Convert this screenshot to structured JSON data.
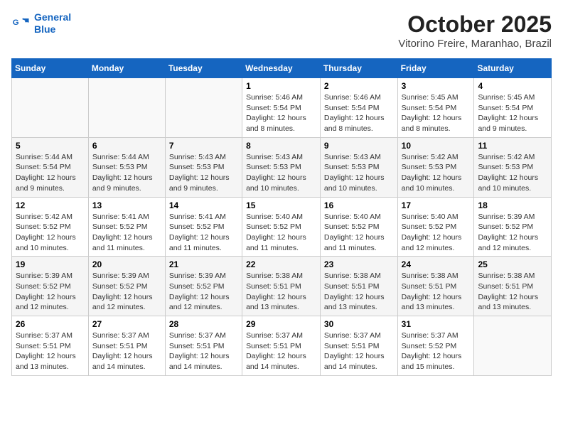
{
  "header": {
    "logo_line1": "General",
    "logo_line2": "Blue",
    "month": "October 2025",
    "location": "Vitorino Freire, Maranhao, Brazil"
  },
  "days_of_week": [
    "Sunday",
    "Monday",
    "Tuesday",
    "Wednesday",
    "Thursday",
    "Friday",
    "Saturday"
  ],
  "weeks": [
    [
      {
        "day": "",
        "info": ""
      },
      {
        "day": "",
        "info": ""
      },
      {
        "day": "",
        "info": ""
      },
      {
        "day": "1",
        "info": "Sunrise: 5:46 AM\nSunset: 5:54 PM\nDaylight: 12 hours and 8 minutes."
      },
      {
        "day": "2",
        "info": "Sunrise: 5:46 AM\nSunset: 5:54 PM\nDaylight: 12 hours and 8 minutes."
      },
      {
        "day": "3",
        "info": "Sunrise: 5:45 AM\nSunset: 5:54 PM\nDaylight: 12 hours and 8 minutes."
      },
      {
        "day": "4",
        "info": "Sunrise: 5:45 AM\nSunset: 5:54 PM\nDaylight: 12 hours and 9 minutes."
      }
    ],
    [
      {
        "day": "5",
        "info": "Sunrise: 5:44 AM\nSunset: 5:54 PM\nDaylight: 12 hours and 9 minutes."
      },
      {
        "day": "6",
        "info": "Sunrise: 5:44 AM\nSunset: 5:53 PM\nDaylight: 12 hours and 9 minutes."
      },
      {
        "day": "7",
        "info": "Sunrise: 5:43 AM\nSunset: 5:53 PM\nDaylight: 12 hours and 9 minutes."
      },
      {
        "day": "8",
        "info": "Sunrise: 5:43 AM\nSunset: 5:53 PM\nDaylight: 12 hours and 10 minutes."
      },
      {
        "day": "9",
        "info": "Sunrise: 5:43 AM\nSunset: 5:53 PM\nDaylight: 12 hours and 10 minutes."
      },
      {
        "day": "10",
        "info": "Sunrise: 5:42 AM\nSunset: 5:53 PM\nDaylight: 12 hours and 10 minutes."
      },
      {
        "day": "11",
        "info": "Sunrise: 5:42 AM\nSunset: 5:53 PM\nDaylight: 12 hours and 10 minutes."
      }
    ],
    [
      {
        "day": "12",
        "info": "Sunrise: 5:42 AM\nSunset: 5:52 PM\nDaylight: 12 hours and 10 minutes."
      },
      {
        "day": "13",
        "info": "Sunrise: 5:41 AM\nSunset: 5:52 PM\nDaylight: 12 hours and 11 minutes."
      },
      {
        "day": "14",
        "info": "Sunrise: 5:41 AM\nSunset: 5:52 PM\nDaylight: 12 hours and 11 minutes."
      },
      {
        "day": "15",
        "info": "Sunrise: 5:40 AM\nSunset: 5:52 PM\nDaylight: 12 hours and 11 minutes."
      },
      {
        "day": "16",
        "info": "Sunrise: 5:40 AM\nSunset: 5:52 PM\nDaylight: 12 hours and 11 minutes."
      },
      {
        "day": "17",
        "info": "Sunrise: 5:40 AM\nSunset: 5:52 PM\nDaylight: 12 hours and 12 minutes."
      },
      {
        "day": "18",
        "info": "Sunrise: 5:39 AM\nSunset: 5:52 PM\nDaylight: 12 hours and 12 minutes."
      }
    ],
    [
      {
        "day": "19",
        "info": "Sunrise: 5:39 AM\nSunset: 5:52 PM\nDaylight: 12 hours and 12 minutes."
      },
      {
        "day": "20",
        "info": "Sunrise: 5:39 AM\nSunset: 5:52 PM\nDaylight: 12 hours and 12 minutes."
      },
      {
        "day": "21",
        "info": "Sunrise: 5:39 AM\nSunset: 5:52 PM\nDaylight: 12 hours and 12 minutes."
      },
      {
        "day": "22",
        "info": "Sunrise: 5:38 AM\nSunset: 5:51 PM\nDaylight: 12 hours and 13 minutes."
      },
      {
        "day": "23",
        "info": "Sunrise: 5:38 AM\nSunset: 5:51 PM\nDaylight: 12 hours and 13 minutes."
      },
      {
        "day": "24",
        "info": "Sunrise: 5:38 AM\nSunset: 5:51 PM\nDaylight: 12 hours and 13 minutes."
      },
      {
        "day": "25",
        "info": "Sunrise: 5:38 AM\nSunset: 5:51 PM\nDaylight: 12 hours and 13 minutes."
      }
    ],
    [
      {
        "day": "26",
        "info": "Sunrise: 5:37 AM\nSunset: 5:51 PM\nDaylight: 12 hours and 13 minutes."
      },
      {
        "day": "27",
        "info": "Sunrise: 5:37 AM\nSunset: 5:51 PM\nDaylight: 12 hours and 14 minutes."
      },
      {
        "day": "28",
        "info": "Sunrise: 5:37 AM\nSunset: 5:51 PM\nDaylight: 12 hours and 14 minutes."
      },
      {
        "day": "29",
        "info": "Sunrise: 5:37 AM\nSunset: 5:51 PM\nDaylight: 12 hours and 14 minutes."
      },
      {
        "day": "30",
        "info": "Sunrise: 5:37 AM\nSunset: 5:51 PM\nDaylight: 12 hours and 14 minutes."
      },
      {
        "day": "31",
        "info": "Sunrise: 5:37 AM\nSunset: 5:52 PM\nDaylight: 12 hours and 15 minutes."
      },
      {
        "day": "",
        "info": ""
      }
    ]
  ]
}
